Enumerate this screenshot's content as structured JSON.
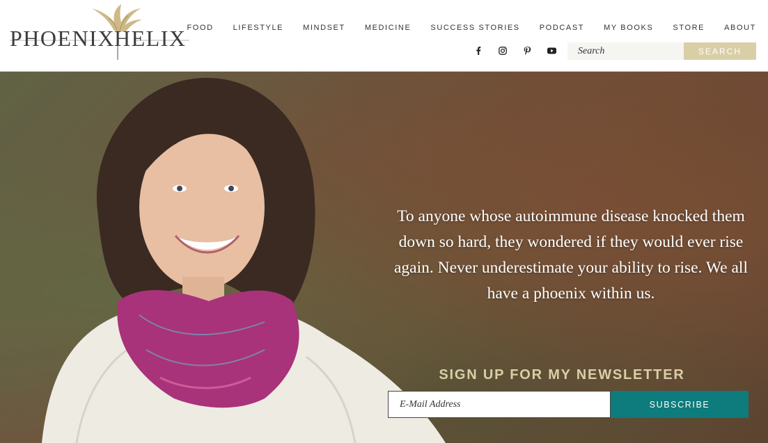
{
  "logo": {
    "word_left": "PHOENIX",
    "word_right": "HELIX",
    "icon": "phoenix-bird-icon"
  },
  "nav": {
    "items": [
      {
        "label": "FOOD"
      },
      {
        "label": "LIFESTYLE"
      },
      {
        "label": "MINDSET"
      },
      {
        "label": "MEDICINE"
      },
      {
        "label": "SUCCESS STORIES"
      },
      {
        "label": "PODCAST"
      },
      {
        "label": "MY BOOKS"
      },
      {
        "label": "STORE"
      },
      {
        "label": "ABOUT"
      }
    ]
  },
  "social": {
    "icons": [
      "facebook-icon",
      "instagram-icon",
      "pinterest-icon",
      "youtube-icon"
    ]
  },
  "search": {
    "placeholder": "Search",
    "button_label": "SEARCH"
  },
  "hero": {
    "quote": "To anyone whose autoimmune disease knocked them down so hard, they wondered if they would ever rise again. Never underestimate your ability to rise. We all have a phoenix within us.",
    "newsletter_title": "SIGN UP FOR MY NEWSLETTER",
    "email_placeholder": "E-Mail Address",
    "subscribe_label": "SUBSCRIBE"
  },
  "colors": {
    "accent_gold": "#d9cfa7",
    "subscribe_teal": "#0e7b7c",
    "nav_text": "#333333"
  }
}
